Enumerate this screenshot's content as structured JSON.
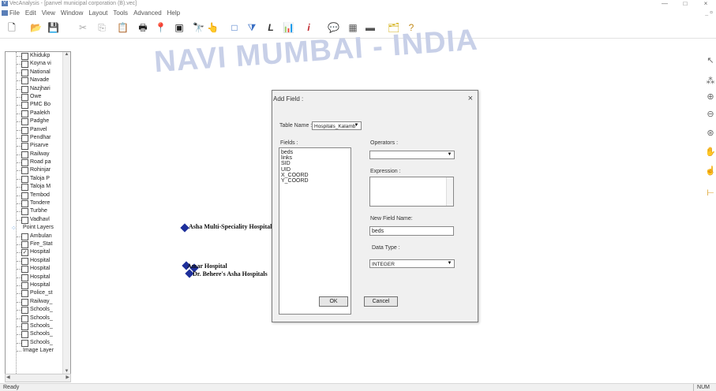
{
  "window": {
    "title": "VecAnalysis - [panvel municipal corporation (B).vec]",
    "minimize": "—",
    "maximize": "□",
    "close": "×"
  },
  "menu": {
    "items": [
      "File",
      "Edit",
      "View",
      "Window",
      "Layout",
      "Tools",
      "Advanced",
      "Help"
    ],
    "mdi_controls": "_ ¤"
  },
  "toolbar": {
    "buttons": [
      {
        "icon": "new-document-icon",
        "glyph": "🗋"
      },
      {
        "icon": "open-folder-icon",
        "glyph": "📂"
      },
      {
        "icon": "save-icon",
        "glyph": "💾"
      },
      {
        "icon": "cut-icon",
        "glyph": "✂"
      },
      {
        "icon": "copy-icon",
        "glyph": "⎘"
      },
      {
        "icon": "paste-icon",
        "glyph": "📋"
      },
      {
        "icon": "print-icon",
        "glyph": "🖶"
      },
      {
        "icon": "pin-icon",
        "glyph": "📍"
      },
      {
        "icon": "layer-icon",
        "glyph": "▣"
      },
      {
        "icon": "binoculars-icon",
        "glyph": "🔭"
      },
      {
        "icon": "query-icon",
        "glyph": "👆"
      },
      {
        "icon": "rectangle-icon",
        "glyph": "□"
      },
      {
        "icon": "filter-icon",
        "glyph": "⧩"
      },
      {
        "icon": "label-icon",
        "glyph": "L"
      },
      {
        "icon": "chart-icon",
        "glyph": "📊"
      },
      {
        "icon": "info-icon",
        "glyph": "i"
      },
      {
        "icon": "comment-icon",
        "glyph": "💬"
      },
      {
        "icon": "table-icon",
        "glyph": "▦"
      },
      {
        "icon": "ruler-icon",
        "glyph": "▬"
      },
      {
        "icon": "export-icon",
        "glyph": "🗂"
      },
      {
        "icon": "help-icon",
        "glyph": "?"
      }
    ]
  },
  "layers": {
    "polygon_items": [
      "Khidukp",
      "Koyna vi",
      "National",
      "Navade",
      "Nazjhari",
      "Owe",
      "PMC Bo",
      "Paalekh",
      "Padghe",
      "Panvel",
      "Pendhar",
      "Pisarve",
      "Railway",
      "Road pa",
      "Rohinjar",
      "Taloja P",
      "Taloja M",
      "Tembod",
      "Tondere",
      "Turbhe",
      "Vadhavl"
    ],
    "point_group": "Point Layers",
    "point_items": [
      {
        "label": "Ambulan",
        "checked": false
      },
      {
        "label": "Fire_Stat",
        "checked": false
      },
      {
        "label": "Hospital",
        "checked": true
      },
      {
        "label": "Hospital",
        "checked": false
      },
      {
        "label": "Hospital",
        "checked": false
      },
      {
        "label": "Hospital",
        "checked": false
      },
      {
        "label": "Hospital",
        "checked": false
      },
      {
        "label": "Police_st",
        "checked": false
      },
      {
        "label": "Railway_",
        "checked": false
      },
      {
        "label": "Schools_",
        "checked": false
      },
      {
        "label": "Schools_",
        "checked": false
      },
      {
        "label": "Schools_",
        "checked": false
      },
      {
        "label": "Schools_",
        "checked": false
      },
      {
        "label": "Schools_",
        "checked": false
      }
    ],
    "image_group": "Image Layer",
    "checkmark": "✓"
  },
  "map": {
    "watermark": "NAVI MUMBAI - INDIA",
    "labels": [
      "Asha Multi-Speciality Hospital",
      "Amar Hospital",
      "Dr. Behere's Asha Hospitals"
    ]
  },
  "dialog": {
    "title": "Add Field :",
    "close": "×",
    "table_name_label": "Table Name :",
    "table_name_value": "Hospitals_Kalamb",
    "fields_label": "Fields :",
    "fields": [
      "beds",
      "links",
      "SID",
      "UID",
      "X_COORD",
      "Y_COORD"
    ],
    "operators_label": "Operators :",
    "operators_value": "",
    "expression_label": "Expression :",
    "new_field_name_label": "New Field Name:",
    "new_field_name_value": "beds",
    "data_type_label": "Data Type :",
    "data_type_value": "INTEGER",
    "ok_label": "OK",
    "cancel_label": "Cancel"
  },
  "status": {
    "text": "Ready",
    "num": "NUM"
  },
  "colors": {
    "marker": "#1e2f9b",
    "watermark": "#c8d0e8",
    "dialog_bg": "#f0f0f0"
  }
}
